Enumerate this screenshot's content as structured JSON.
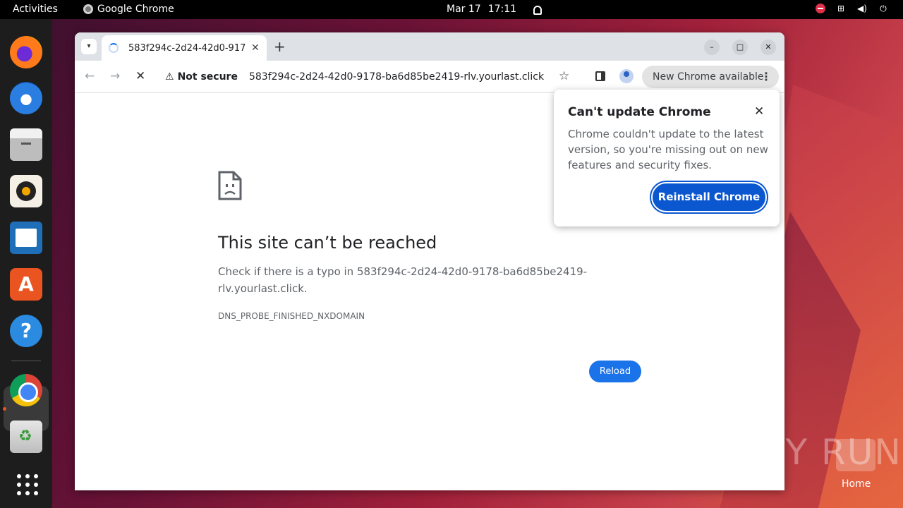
{
  "topbar": {
    "activities": "Activities",
    "app_name": "Google Chrome",
    "date": "Mar 17",
    "time": "17:11"
  },
  "dock": {
    "items": [
      "firefox",
      "thunderbird",
      "files",
      "rhythmbox",
      "libreoffice-writer",
      "app-center",
      "help",
      "google-chrome",
      "trash",
      "show-apps"
    ]
  },
  "browser": {
    "tab_title": "583f294c-2d24-42d0-917",
    "tab_close": "✕",
    "new_tab": "+",
    "win_min": "–",
    "win_max": "□",
    "win_close": "✕",
    "security_label": "Not secure",
    "url": "583f294c-2d24-42d0-9178-ba6d85be2419-rlv.yourlast.click",
    "update_chip": "New Chrome available"
  },
  "error_page": {
    "title": "This site can’t be reached",
    "message": "Check if there is a typo in 583f294c-2d24-42d0-9178-ba6d85be2419-rlv.yourlast.click.",
    "code": "DNS_PROBE_FINISHED_NXDOMAIN",
    "reload_label": "Reload"
  },
  "popup": {
    "title": "Can't update Chrome",
    "body": "Chrome couldn't update to the latest version, so you're missing out on new features and security fixes.",
    "button": "Reinstall Chrome",
    "close": "✕"
  },
  "desktop": {
    "watermark": "ANY RUN",
    "home_label": "Home"
  },
  "colors": {
    "accent_blue": "#1a73e8",
    "popup_button": "#0b57d0",
    "ubuntu_orange": "#e95420"
  }
}
